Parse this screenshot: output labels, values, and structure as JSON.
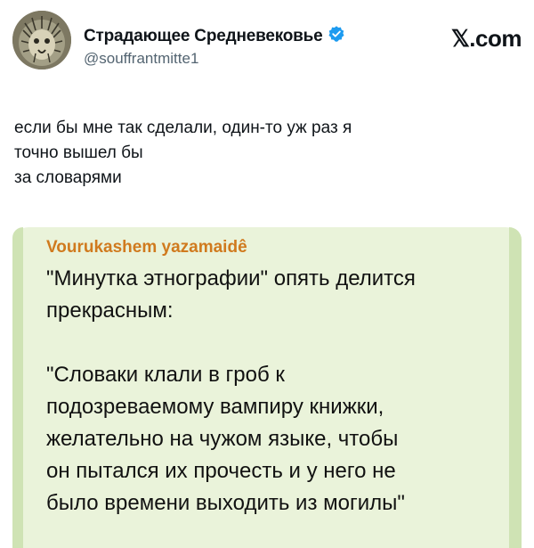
{
  "author": {
    "display_name": "Страдающее Средневековье",
    "handle": "@souffrantmitte1",
    "verified": true
  },
  "site_brand": "𝕏.com",
  "tweet": {
    "lines": [
      "если бы мне так сделали, один-то уж раз я",
      "точно вышел бы",
      "за словарями"
    ]
  },
  "quote": {
    "author": "Vourukashem yazamaidê",
    "lines": [
      "\"Минутка этнографии\" опять делится",
      "прекрасным:",
      "",
      "\"Словаки клали в гроб к",
      "подозреваемому вампиру книжки,",
      "желательно на чужом языке, чтобы",
      "он пытался их прочесть и у него не",
      "было времени выходить из могилы\""
    ]
  },
  "colors": {
    "verified_badge": "#1d9bf0",
    "quote_background": "#eaf3da",
    "quote_author": "#d07a1e"
  },
  "icons": {
    "avatar": "medieval-portrait-avatar",
    "verified": "verified-badge-icon"
  }
}
